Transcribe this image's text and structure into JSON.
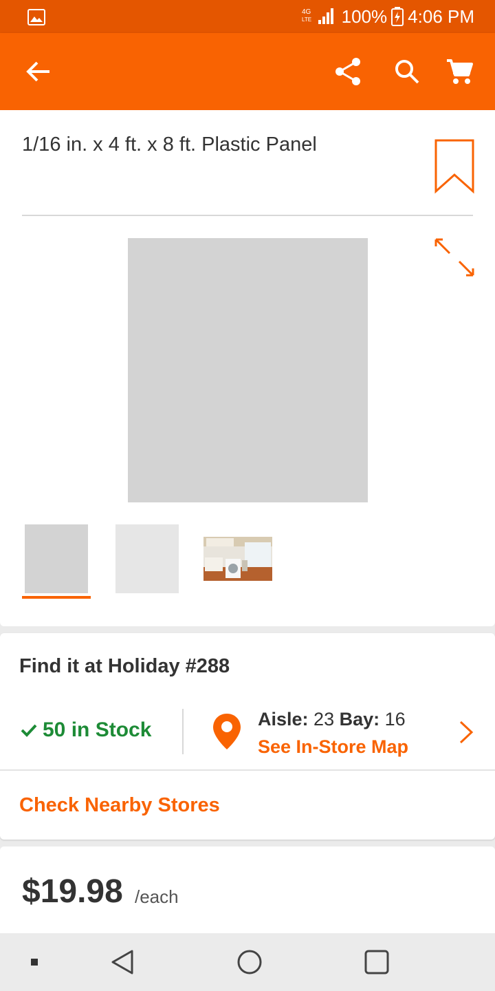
{
  "status_bar": {
    "network": "4G LTE",
    "battery": "100%",
    "time": "4:06 PM"
  },
  "app_bar": {
    "icons": [
      "back-arrow-icon",
      "share-icon",
      "search-icon",
      "cart-icon"
    ],
    "color": "#f96302"
  },
  "product": {
    "title": "1/16 in. x 4 ft. x 8 ft. Plastic Panel",
    "thumbnails": [
      "thumbnail-1",
      "thumbnail-2",
      "thumbnail-3"
    ],
    "selected_thumbnail": 0
  },
  "store": {
    "heading": "Find it at Holiday #288",
    "stock_text": "50 in Stock",
    "aisle_label": "Aisle:",
    "aisle_value": "23",
    "bay_label": "Bay:",
    "bay_value": "16",
    "map_link": "See In-Store Map",
    "nearby_link": "Check Nearby Stores"
  },
  "price": {
    "amount": "$19.98",
    "unit": "/each"
  },
  "colors": {
    "accent": "#f96302",
    "status_bar": "#e45600",
    "in_stock": "#1d8b36"
  }
}
